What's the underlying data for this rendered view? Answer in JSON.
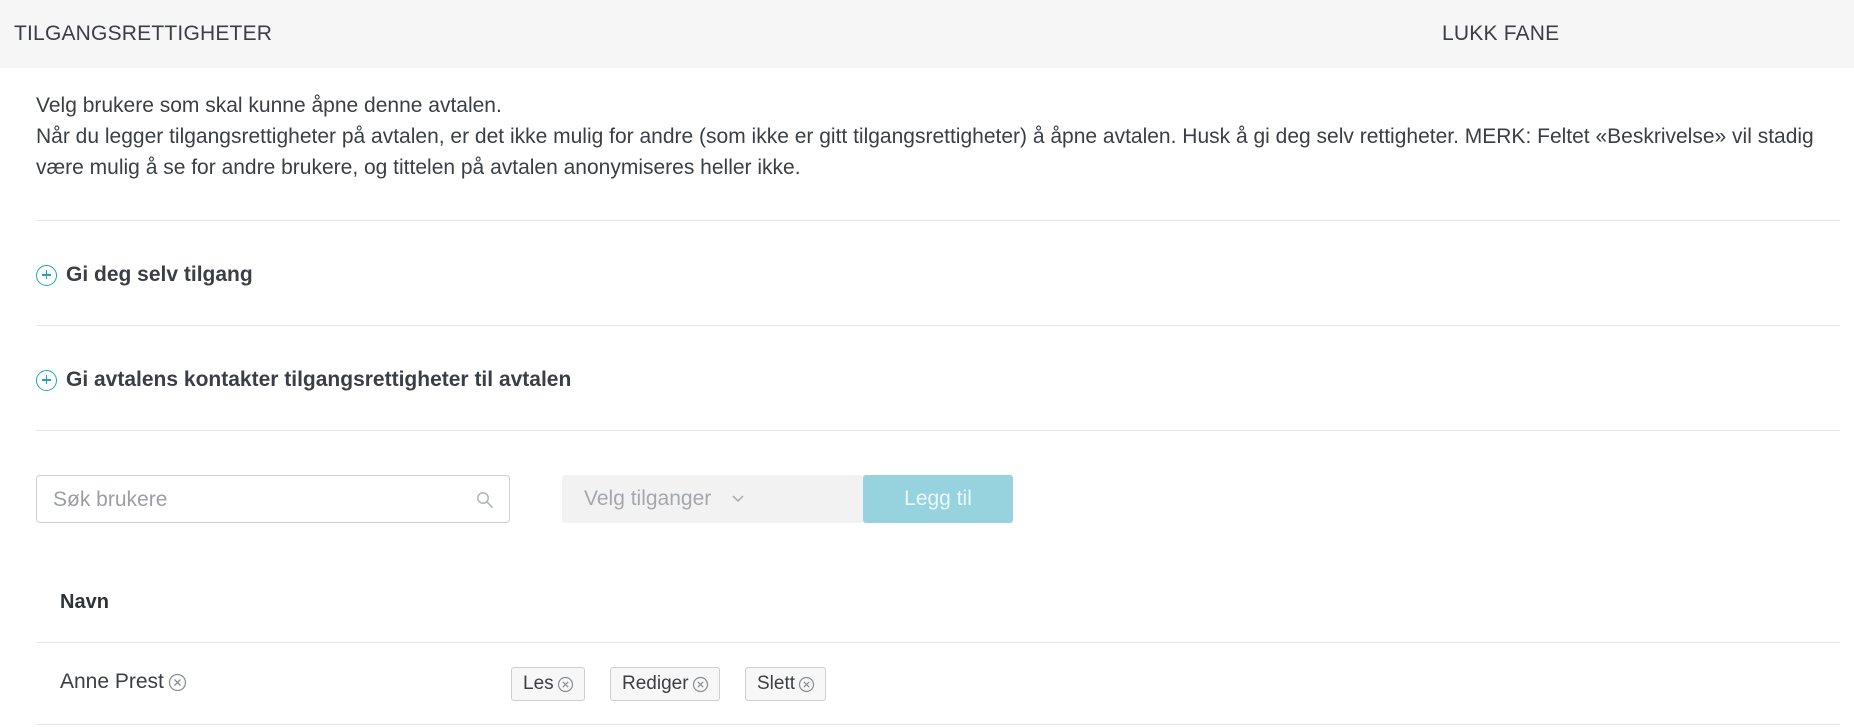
{
  "header": {
    "title": "TILGANGSRETTIGHETER",
    "close_label": "LUKK FANE"
  },
  "intro": {
    "line1": "Velg brukere som skal kunne åpne denne avtalen.",
    "line2": "Når du legger tilgangsrettigheter på avtalen, er det ikke mulig for andre (som ikke er gitt tilgangsrettigheter) å åpne avtalen. Husk å gi deg selv rettigheter. MERK: Feltet «Beskrivelse» vil stadig være mulig å se for andre brukere, og tittelen på avtalen anonymiseres heller ikke."
  },
  "sections": {
    "self_access": "Gi deg selv tilgang",
    "contacts_access": "Gi avtalens kontakter tilgangsrettigheter til avtalen"
  },
  "controls": {
    "search_placeholder": "Søk brukere",
    "select_label": "Velg tilganger",
    "add_button": "Legg til"
  },
  "table": {
    "header_name": "Navn",
    "rows": [
      {
        "name": "Anne Prest",
        "permissions": [
          "Les",
          "Rediger",
          "Slett"
        ]
      }
    ]
  },
  "colors": {
    "accent": "#20a4b8",
    "button_disabled": "#97d3df",
    "header_bg": "#f6f6f6"
  },
  "icons": [
    "plus-circle-icon",
    "search-icon",
    "chevron-down-icon",
    "remove-circle-icon"
  ]
}
